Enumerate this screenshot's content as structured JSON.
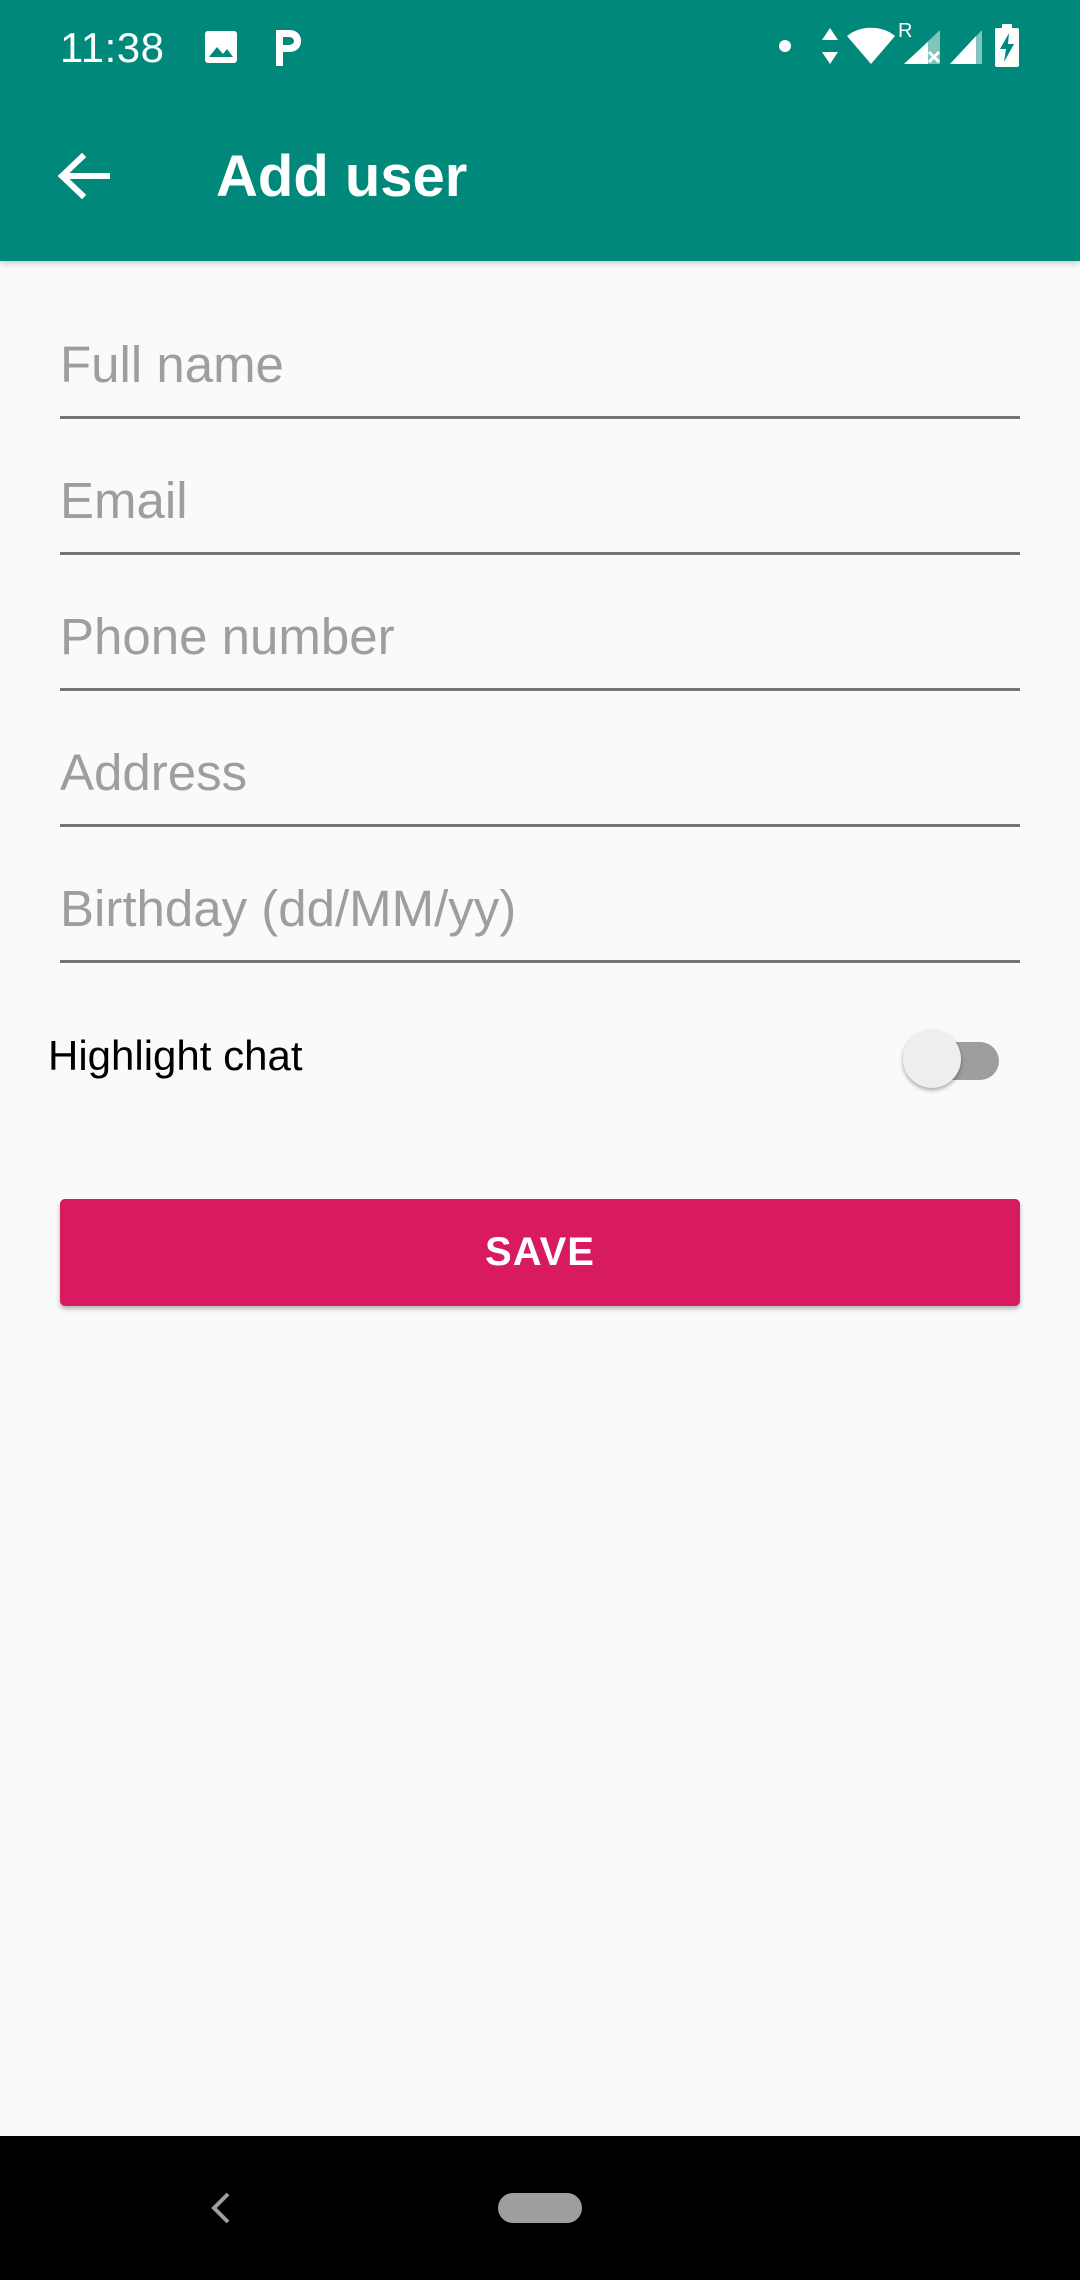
{
  "status_bar": {
    "time": "11:38",
    "icons": [
      "image-icon",
      "parking-icon",
      "notification-dot-icon",
      "data-arrows-icon",
      "wifi-icon",
      "signal-roaming-icon",
      "signal-icon",
      "battery-charging-icon"
    ],
    "roaming_mark": "R"
  },
  "toolbar": {
    "title": "Add user",
    "back_icon": "arrow-left-icon"
  },
  "form": {
    "fields": [
      {
        "placeholder": "Full name",
        "value": ""
      },
      {
        "placeholder": "Email",
        "value": ""
      },
      {
        "placeholder": "Phone number",
        "value": ""
      },
      {
        "placeholder": "Address",
        "value": ""
      },
      {
        "placeholder": "Birthday (dd/MM/yy)",
        "value": ""
      }
    ],
    "highlight_chat": {
      "label": "Highlight chat",
      "checked": false
    },
    "save_label": "SAVE"
  },
  "nav_bar": {
    "back_icon": "chevron-left-icon",
    "home_icon": "home-pill-icon"
  },
  "colors": {
    "primary": "#00897b",
    "accent": "#d81b60",
    "background": "#fafafa",
    "placeholder": "#9e9e9e",
    "underline": "#757575"
  }
}
